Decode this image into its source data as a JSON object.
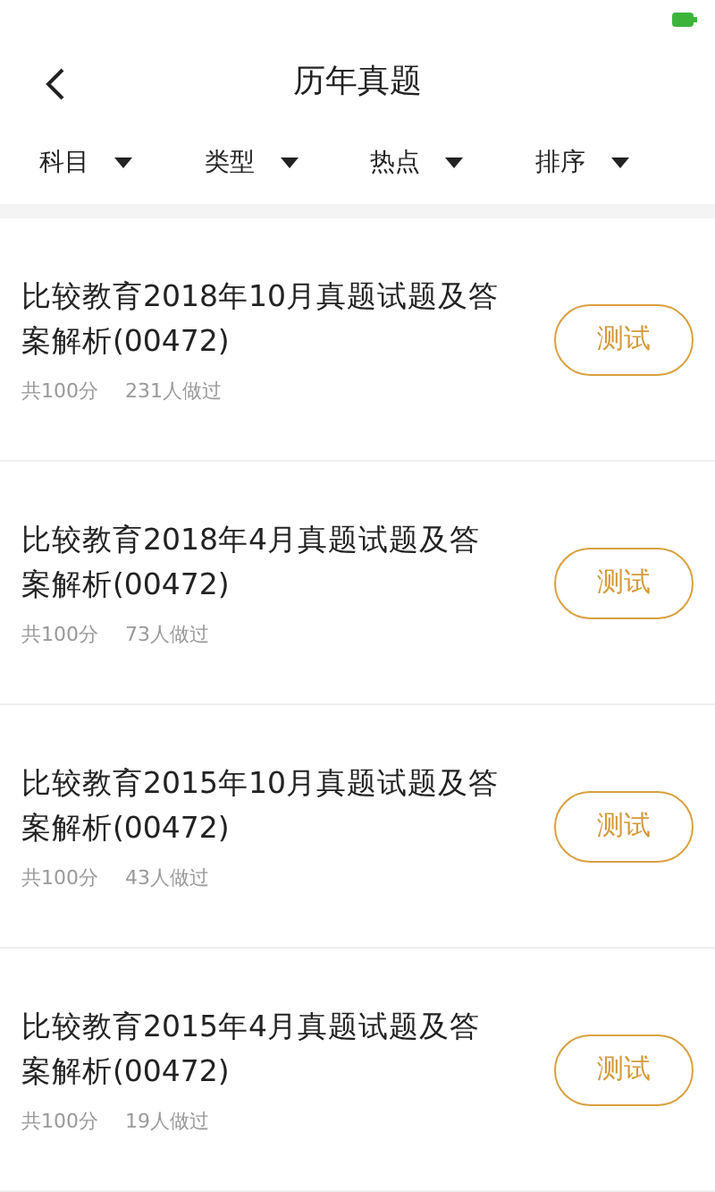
{
  "header": {
    "title": "历年真题"
  },
  "filters": [
    {
      "label": "科目"
    },
    {
      "label": "类型"
    },
    {
      "label": "热点"
    },
    {
      "label": "排序"
    }
  ],
  "exams": [
    {
      "title": "比较教育2018年10月真题试题及答案解析(00472)",
      "score": "共100分",
      "taken": "231人做过",
      "action": "测试"
    },
    {
      "title": "比较教育2018年4月真题试题及答案解析(00472)",
      "score": "共100分",
      "taken": "73人做过",
      "action": "测试"
    },
    {
      "title": "比较教育2015年10月真题试题及答案解析(00472)",
      "score": "共100分",
      "taken": "43人做过",
      "action": "测试"
    },
    {
      "title": "比较教育2015年4月真题试题及答案解析(00472)",
      "score": "共100分",
      "taken": "19人做过",
      "action": "测试"
    }
  ]
}
